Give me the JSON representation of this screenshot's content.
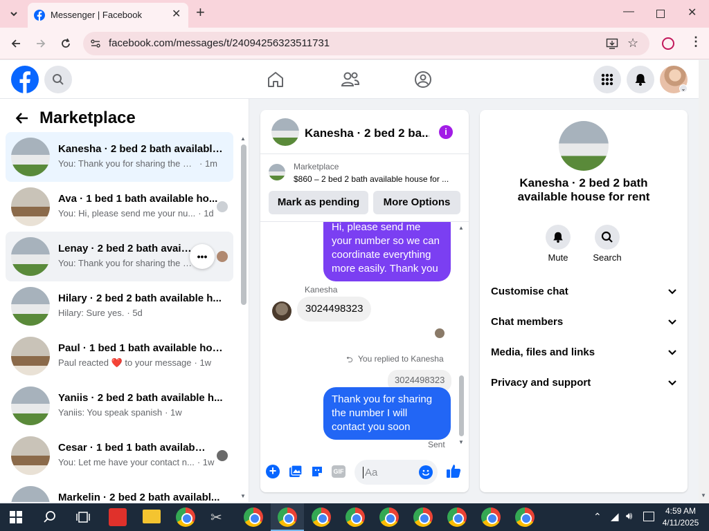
{
  "browser": {
    "tab_title": "Messenger | Facebook",
    "url": "facebook.com/messages/t/24094256323511731"
  },
  "left": {
    "title": "Marketplace",
    "chats": [
      {
        "name": "Kanesha · 2 bed 2 bath available...",
        "preview": "You: Thank you for sharing the nu...",
        "time": "· 1m"
      },
      {
        "name": "Ava · 1 bed 1 bath available ho...",
        "preview": "You: Hi, please send me your nu...",
        "time": "· 1d"
      },
      {
        "name": "Lenay · 2 bed 2 bath availabl...",
        "preview": "You: Thank you for sharing the n...",
        "time": ""
      },
      {
        "name": "Hilary · 2 bed 2 bath available h...",
        "preview": "Hilary: Sure yes.",
        "time": "· 5d"
      },
      {
        "name": "Paul · 1 bed 1 bath available hou...",
        "preview": "Paul reacted ❤️ to your message",
        "time": "· 1w"
      },
      {
        "name": "Yaniis · 2 bed 2 bath available h...",
        "preview": "Yaniis: You speak spanish",
        "time": "· 1w"
      },
      {
        "name": "Cesar · 1 bed 1 bath available ...",
        "preview": "You: Let me have your contact n...",
        "time": "· 1w"
      },
      {
        "name": "Markelin · 2 bed 2 bath availabl...",
        "preview": "",
        "time": ""
      }
    ],
    "more_icon": "•••"
  },
  "conversation": {
    "header_name": "Kanesha · 2 bed 2 ba...",
    "listing_label": "Marketplace",
    "listing_title": "$860 – 2 bed 2 bath available house for ...",
    "btn_pending": "Mark as pending",
    "btn_options": "More Options",
    "msg_purple": "Hi, please send me your number so we can coordinate everything more easily. Thank you",
    "sender": "Kanesha",
    "msg_grey": "3024498323",
    "replied_label": "You replied to Kanesha",
    "quoted": "3024498323",
    "msg_blue": "Thank you for sharing the number I will contact you soon",
    "sent_label": "Sent",
    "input_placeholder": "Aa",
    "gif_label": "GIF"
  },
  "info": {
    "title": "Kanesha · 2 bed 2 bath available house for rent",
    "mute": "Mute",
    "search": "Search",
    "sections": [
      "Customise chat",
      "Chat members",
      "Media, files and links",
      "Privacy and support"
    ]
  },
  "taskbar": {
    "time": "4:59 AM",
    "date": "4/11/2025"
  },
  "colors": {
    "fb_blue": "#0866ff",
    "purple_bubble": "#7b3ff2",
    "blue_bubble": "#2266f5"
  }
}
